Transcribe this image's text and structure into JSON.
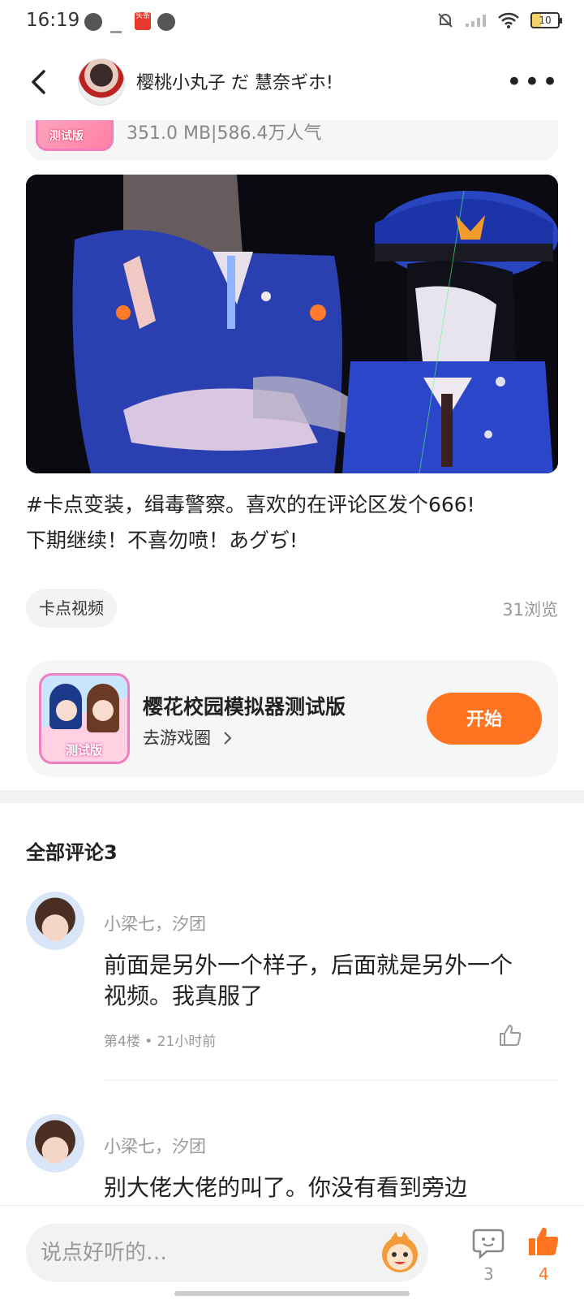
{
  "status_bar": {
    "time": "16:19",
    "battery": "10"
  },
  "header": {
    "author_name": "樱桃小丸子  だ   慧奈ギホ!"
  },
  "top_card": {
    "meta": "351.0 MB|586.4万人气",
    "thumb_badge": "测试版"
  },
  "post": {
    "caption_line1": "#卡点变装，缉毒警察。喜欢的在评论区发个666!",
    "caption_line2": "下期继续！不喜勿喷！あグぢ!",
    "tag": "卡点视频",
    "views": "31浏览"
  },
  "app_card": {
    "name": "樱花校园模拟器测试版",
    "link": "去游戏圈",
    "button": "开始",
    "badge": "测试版"
  },
  "comments_section": {
    "title": "全部评论3",
    "items": [
      {
        "author": "小梁七，汐团",
        "text": "前面是另外一个样子，后面就是另外一个视频。我真服了",
        "meta": "第4楼 • 21小时前"
      },
      {
        "author": "小梁七，汐团",
        "text": "别大佬大佬的叫了。你没有看到旁边"
      }
    ]
  },
  "bottom_bar": {
    "placeholder": "说点好听的…",
    "comment_count": "3",
    "like_count": "4"
  },
  "colors": {
    "accent": "#ff7421",
    "badge_pink": "#f07fc0"
  }
}
